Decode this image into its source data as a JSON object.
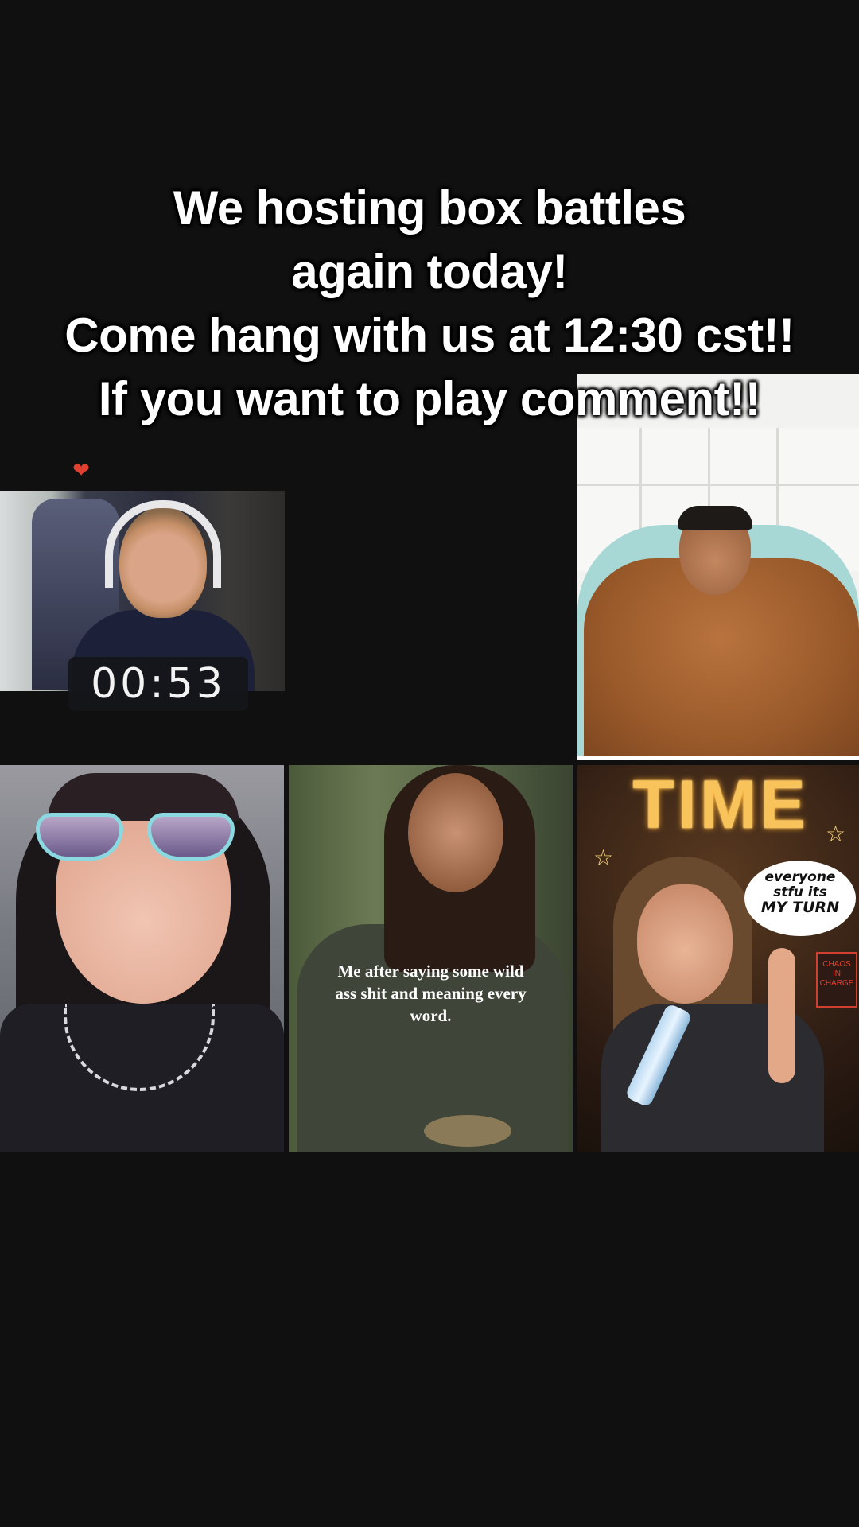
{
  "caption": {
    "line1": "We hosting box battles",
    "line2": "again today!",
    "line3": "Come hang with us at 12:30 cst!!",
    "line4": "If you want to play comment!!"
  },
  "stream": {
    "timer": "00:53"
  },
  "tiles": {
    "doll": {
      "caption_line1": "Me after saying some wild",
      "caption_line2": "ass shit and meaning every",
      "caption_line3": "word."
    },
    "showtime": {
      "sign": "TIME",
      "bubble_line1": "everyone",
      "bubble_line2": "stfu its",
      "bubble_line3": "MY TURN",
      "side_sign": "CHAOS IN CHARGE"
    }
  },
  "colors": {
    "background": "#101010",
    "caption_text": "#ffffff",
    "sign_glow": "#f7c35a"
  }
}
